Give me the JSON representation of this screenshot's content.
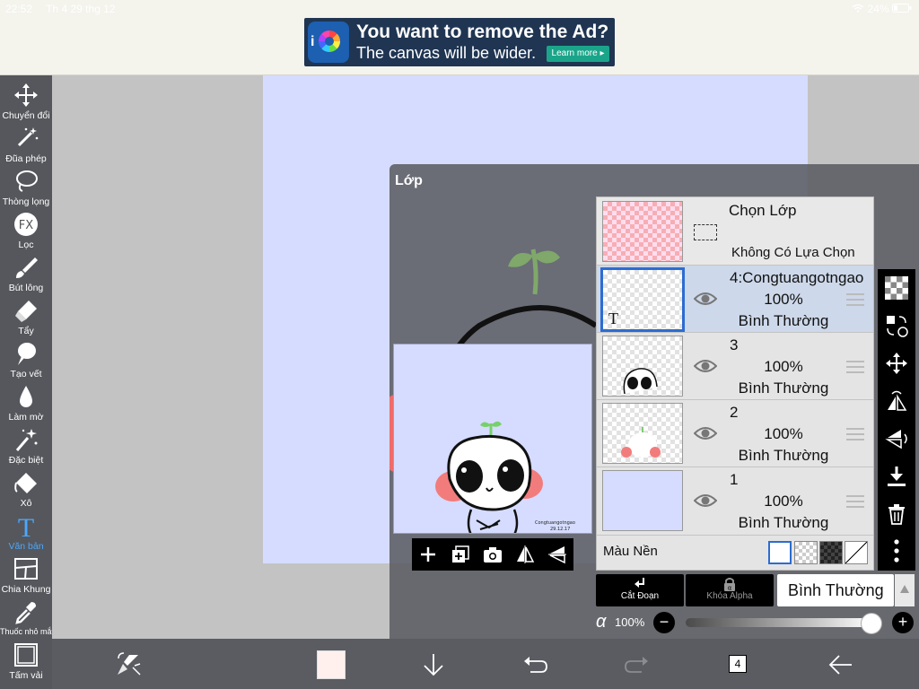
{
  "status": {
    "time": "22:52",
    "date": "Th 4 29 thg 12",
    "battery": "24%"
  },
  "ad": {
    "title": "You want to remove the Ad?",
    "subtitle": "The canvas will be wider.",
    "button": "Learn more ▸"
  },
  "tools": [
    {
      "name": "move",
      "label": "Chuyển đổi"
    },
    {
      "name": "magic-wand",
      "label": "Đũa phép"
    },
    {
      "name": "lasso",
      "label": "Thòng lọng"
    },
    {
      "name": "filter",
      "label": "Lọc"
    },
    {
      "name": "brush",
      "label": "Bút lông"
    },
    {
      "name": "eraser",
      "label": "Tẩy"
    },
    {
      "name": "smudge",
      "label": "Tạo vết"
    },
    {
      "name": "blur",
      "label": "Làm mờ"
    },
    {
      "name": "special",
      "label": "Đặc biệt"
    },
    {
      "name": "fill",
      "label": "Xô"
    },
    {
      "name": "text",
      "label": "Văn bản",
      "active": true
    },
    {
      "name": "frame-divider",
      "label": "Chia Khung"
    },
    {
      "name": "eyedropper",
      "label": "Thuốc nhỏ mắt"
    },
    {
      "name": "canvas",
      "label": "Tấm vải"
    }
  ],
  "layer_panel": {
    "title": "Lớp",
    "selection_layer": {
      "title": "Chọn Lớp",
      "status": "Không Có Lựa Chọn"
    },
    "layers": [
      {
        "name": "4:Congtuangotngao",
        "opacity": "100%",
        "blend": "Bình Thường",
        "selected": true
      },
      {
        "name": "3",
        "opacity": "100%",
        "blend": "Bình Thường"
      },
      {
        "name": "2",
        "opacity": "100%",
        "blend": "Bình Thường"
      },
      {
        "name": "1",
        "opacity": "100%",
        "blend": "Bình Thường"
      }
    ],
    "background": {
      "label": "Màu Nền"
    },
    "clip_button": "Cắt Đoạn",
    "alpha_lock_button": "Khóa Alpha",
    "blend_mode": "Bình Thường",
    "alpha_symbol": "α",
    "alpha_value": "100%",
    "alpha_fraction": 1.0,
    "minus": "−",
    "plus": "+"
  },
  "preview": {
    "watermark_line1": "Congtuangotngao",
    "watermark_line2": "29.12.17"
  },
  "bottom": {
    "layer_count": "4",
    "color": "#fff0ee"
  },
  "colors": {
    "accent": "#2d6cd1",
    "active_tool": "#4aa8ff",
    "canvas": "#d5dcff"
  }
}
